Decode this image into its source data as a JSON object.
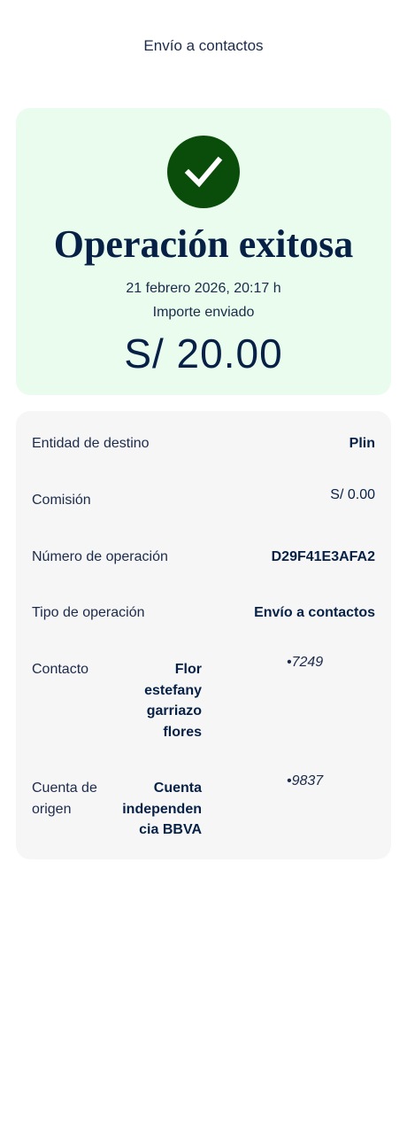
{
  "header": {
    "title": "Envío a contactos"
  },
  "success": {
    "title": "Operación exitosa",
    "date": "21 febrero 2026, 20:17 h",
    "subtitle": "Importe enviado",
    "amount": "S/ 20.00",
    "icon": "check-icon"
  },
  "details": {
    "entidad": {
      "label": "Entidad de destino",
      "value": "Plin"
    },
    "comision": {
      "label": "Comisión",
      "value": "S/ 0.00"
    },
    "numero": {
      "label": "Número de operación",
      "value": "D29F41E3AFA2"
    },
    "tipo": {
      "label": "Tipo de operación",
      "value": "Envío a contactos"
    },
    "contacto": {
      "label": "Contacto",
      "name_lines": [
        "Flor",
        "estefany",
        "garriazo",
        "flores"
      ],
      "masked": "•7249"
    },
    "cuenta": {
      "label_lines": [
        "Cuenta de",
        "origen"
      ],
      "name_lines": [
        "Cuenta",
        "independen",
        "cia BBVA"
      ],
      "masked": "•9837"
    }
  },
  "colors": {
    "success_bg": "#e9fcee",
    "check_bg": "#0a4d0a",
    "text_navy": "#072146",
    "card_bg": "#f6f6f7"
  }
}
